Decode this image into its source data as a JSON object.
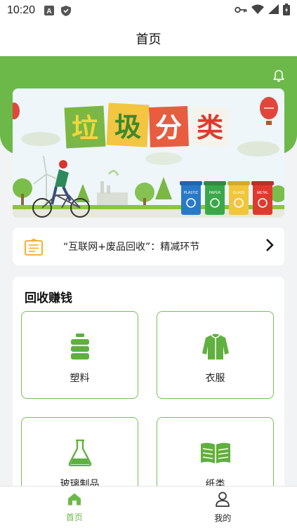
{
  "status_bar": {
    "time": "10:20",
    "left_icons": [
      "a-icon",
      "shield-icon"
    ],
    "right_icons": [
      "key-icon",
      "wifi-icon",
      "signal-icon",
      "battery-icon"
    ]
  },
  "header": {
    "title": "首页"
  },
  "banner": {
    "title_chars": [
      "垃",
      "圾",
      "分",
      "类"
    ],
    "bins": [
      "PLASTIC",
      "PAPER",
      "GLASS",
      "METAL"
    ]
  },
  "notice": {
    "text": "“互联网+废品回收”：精减环节"
  },
  "recycle": {
    "title": "回收赚钱",
    "categories": [
      {
        "label": "塑料",
        "icon": "plastic-icon"
      },
      {
        "label": "衣服",
        "icon": "jacket-icon"
      },
      {
        "label": "玻璃制品",
        "icon": "flask-icon"
      },
      {
        "label": "纸类",
        "icon": "book-icon"
      }
    ]
  },
  "tabbar": {
    "tabs": [
      {
        "label": "首页",
        "icon": "home-icon",
        "active": true
      },
      {
        "label": "我的",
        "icon": "user-icon",
        "active": false
      }
    ]
  },
  "colors": {
    "brand_green": "#6cb94a",
    "card_border": "#74c05a"
  }
}
